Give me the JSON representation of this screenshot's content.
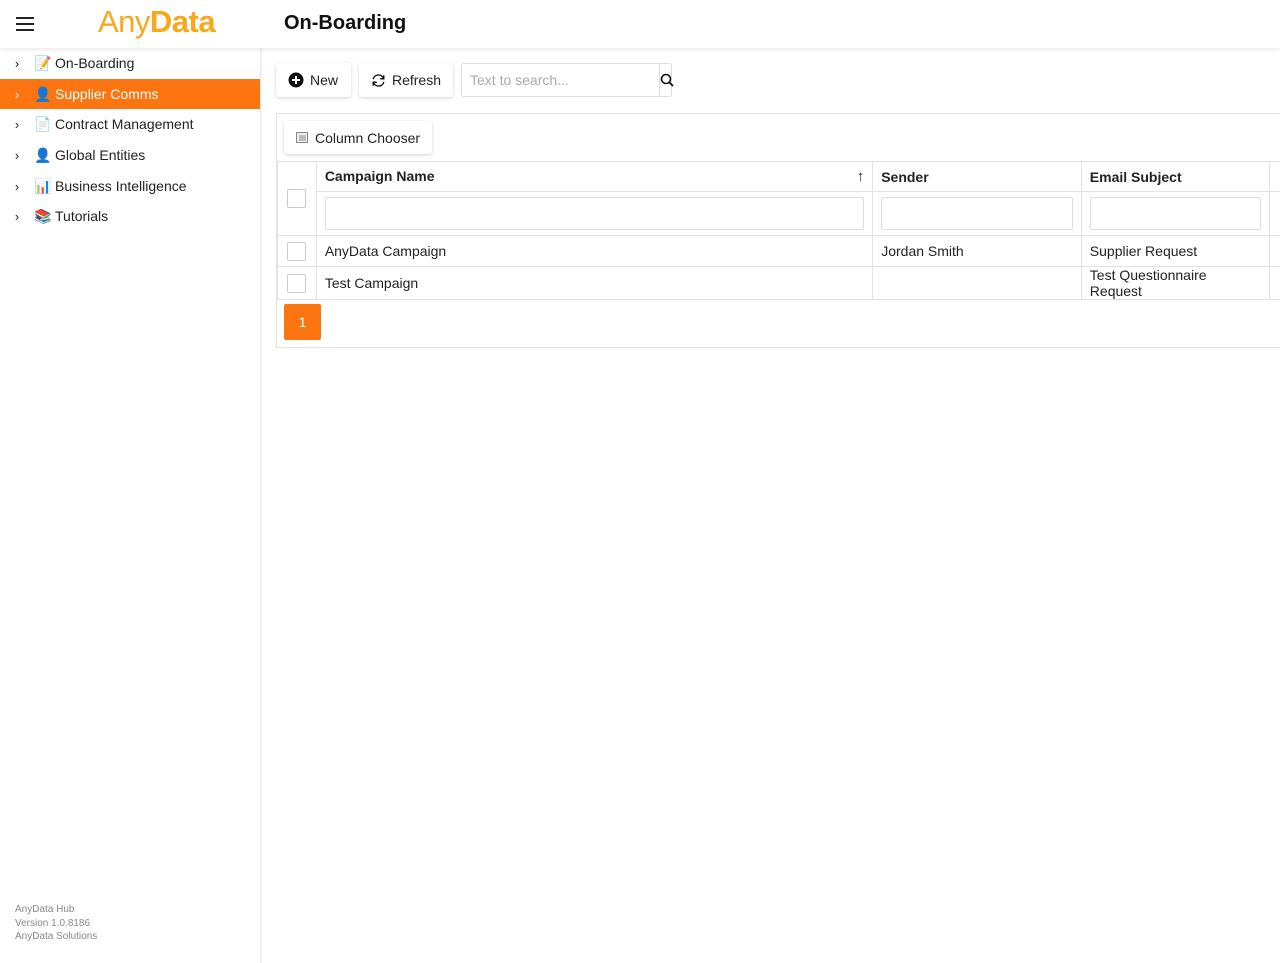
{
  "header": {
    "logo_light": "Any",
    "logo_bold": "Data",
    "title": "On-Boarding"
  },
  "sidebar": {
    "items": [
      {
        "label": "On-Boarding",
        "icon": "📝"
      },
      {
        "label": "Supplier Comms",
        "icon": "👤"
      },
      {
        "label": "Contract Management",
        "icon": "📄"
      },
      {
        "label": "Global Entities",
        "icon": "👤"
      },
      {
        "label": "Business Intelligence",
        "icon": "📊"
      },
      {
        "label": "Tutorials",
        "icon": "📚"
      }
    ],
    "footer": [
      "AnyData Hub",
      "Version 1.0.8186",
      "AnyData Solutions"
    ]
  },
  "toolbar": {
    "new_label": "New",
    "refresh_label": "Refresh",
    "search_placeholder": "Text to search..."
  },
  "grid": {
    "column_chooser": "Column Chooser",
    "columns": [
      "Campaign Name",
      "Sender",
      "Email Subject"
    ],
    "rows": [
      [
        "AnyData Campaign",
        "Jordan Smith",
        "Supplier Request"
      ],
      [
        "Test Campaign",
        "",
        "Test Questionnaire Request"
      ]
    ],
    "page": "1"
  },
  "colors": {
    "accent": "#fc7510",
    "logo": "#f8a81a"
  }
}
